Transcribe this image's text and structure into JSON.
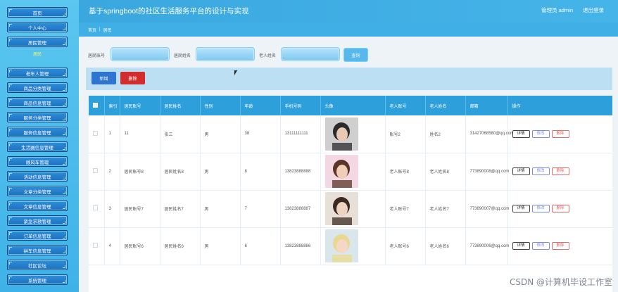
{
  "header": {
    "title": "基于springboot的社区生活服务平台的设计与实现",
    "user": "管理员 admin",
    "logout": "退出登录"
  },
  "breadcrumb": {
    "home": "首页",
    "sep": "|",
    "current": "居民"
  },
  "sidebar": {
    "items": [
      {
        "label": "首页"
      },
      {
        "label": "个人中心"
      },
      {
        "label": "居民管理"
      },
      {
        "label": "居民",
        "sub": true
      },
      {
        "label": "老年人管理"
      },
      {
        "label": "商品分类管理"
      },
      {
        "label": "商品信息管理"
      },
      {
        "label": "服务分类管理"
      },
      {
        "label": "服务信息管理"
      },
      {
        "label": "生活圈信息管理"
      },
      {
        "label": "顺风车管理"
      },
      {
        "label": "活动信息管理"
      },
      {
        "label": "文章分类管理"
      },
      {
        "label": "文章信息管理"
      },
      {
        "label": "紧急求救管理"
      },
      {
        "label": "订单信息管理"
      },
      {
        "label": "拼车信息管理"
      },
      {
        "label": "社区论坛"
      },
      {
        "label": "系统管理"
      }
    ]
  },
  "search": {
    "fields": [
      {
        "label": "居民账号",
        "value": ""
      },
      {
        "label": "居民姓名",
        "value": ""
      },
      {
        "label": "老人姓名",
        "value": ""
      }
    ],
    "button": "查询"
  },
  "actions": {
    "add": "新增",
    "delete": "删除"
  },
  "table": {
    "headers": [
      "",
      "索引",
      "居民账号",
      "居民姓名",
      "性别",
      "年龄",
      "手机号码",
      "头像",
      "老人账号",
      "老人姓名",
      "邮箱",
      "操作"
    ],
    "ops": {
      "detail": "详情",
      "edit": "修改",
      "delete": "删除"
    },
    "rows": [
      {
        "index": "1",
        "account": "11",
        "name": "张三",
        "gender": "男",
        "age": "38",
        "phone": "13111111111",
        "elder_account": "账号2",
        "elder_name": "姓名2",
        "email": "31427068580@qq.com"
      },
      {
        "index": "2",
        "account": "居民账号8",
        "name": "居民姓名8",
        "gender": "男",
        "age": "8",
        "phone": "13823888888",
        "elder_account": "老人账号8",
        "elder_name": "老人姓名8",
        "email": "773890008@qq.com"
      },
      {
        "index": "3",
        "account": "居民账号7",
        "name": "居民姓名7",
        "gender": "男",
        "age": "7",
        "phone": "13823888887",
        "elder_account": "老人账号7",
        "elder_name": "老人姓名7",
        "email": "773890007@qq.com"
      },
      {
        "index": "4",
        "account": "居民账号6",
        "name": "居民姓名6",
        "gender": "男",
        "age": "6",
        "phone": "13823888886",
        "elder_account": "老人账号6",
        "elder_name": "老人姓名6",
        "email": "773890006@qq.com"
      }
    ]
  },
  "watermark": "CSDN @计算机毕设工作室"
}
